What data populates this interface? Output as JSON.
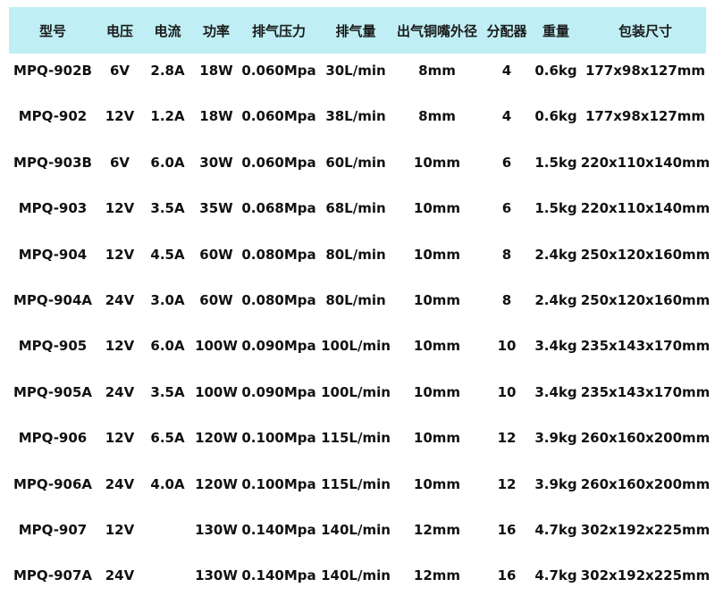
{
  "header": {
    "model": "型号",
    "voltage": "电压",
    "current": "电流",
    "power": "功率",
    "pressure": "排气压力",
    "flow": "排气量",
    "nozzle": "出气铜嘴外径",
    "distributor": "分配器",
    "weight": "重量",
    "package_size": "包装尺寸"
  },
  "rows": [
    {
      "model": "MPQ-902B",
      "voltage": "6V",
      "current": "2.8A",
      "power": "18W",
      "pressure": "0.060Mpa",
      "flow": "30L/min",
      "nozzle": "8mm",
      "distributor": "4",
      "weight": "0.6kg",
      "package_size": "177x98x127mm"
    },
    {
      "model": "MPQ-902",
      "voltage": "12V",
      "current": "1.2A",
      "power": "18W",
      "pressure": "0.060Mpa",
      "flow": "38L/min",
      "nozzle": "8mm",
      "distributor": "4",
      "weight": "0.6kg",
      "package_size": "177x98x127mm"
    },
    {
      "model": "MPQ-903B",
      "voltage": "6V",
      "current": "6.0A",
      "power": "30W",
      "pressure": "0.060Mpa",
      "flow": "60L/min",
      "nozzle": "10mm",
      "distributor": "6",
      "weight": "1.5kg",
      "package_size": "220x110x140mm"
    },
    {
      "model": "MPQ-903",
      "voltage": "12V",
      "current": "3.5A",
      "power": "35W",
      "pressure": "0.068Mpa",
      "flow": "68L/min",
      "nozzle": "10mm",
      "distributor": "6",
      "weight": "1.5kg",
      "package_size": "220x110x140mm"
    },
    {
      "model": "MPQ-904",
      "voltage": "12V",
      "current": "4.5A",
      "power": "60W",
      "pressure": "0.080Mpa",
      "flow": "80L/min",
      "nozzle": "10mm",
      "distributor": "8",
      "weight": "2.4kg",
      "package_size": "250x120x160mm"
    },
    {
      "model": "MPQ-904A",
      "voltage": "24V",
      "current": "3.0A",
      "power": "60W",
      "pressure": "0.080Mpa",
      "flow": "80L/min",
      "nozzle": "10mm",
      "distributor": "8",
      "weight": "2.4kg",
      "package_size": "250x120x160mm"
    },
    {
      "model": "MPQ-905",
      "voltage": "12V",
      "current": "6.0A",
      "power": "100W",
      "pressure": "0.090Mpa",
      "flow": "100L/min",
      "nozzle": "10mm",
      "distributor": "10",
      "weight": "3.4kg",
      "package_size": "235x143x170mm"
    },
    {
      "model": "MPQ-905A",
      "voltage": "24V",
      "current": "3.5A",
      "power": "100W",
      "pressure": "0.090Mpa",
      "flow": "100L/min",
      "nozzle": "10mm",
      "distributor": "10",
      "weight": "3.4kg",
      "package_size": "235x143x170mm"
    },
    {
      "model": "MPQ-906",
      "voltage": "12V",
      "current": "6.5A",
      "power": "120W",
      "pressure": "0.100Mpa",
      "flow": "115L/min",
      "nozzle": "10mm",
      "distributor": "12",
      "weight": "3.9kg",
      "package_size": "260x160x200mm"
    },
    {
      "model": "MPQ-906A",
      "voltage": "24V",
      "current": "4.0A",
      "power": "120W",
      "pressure": "0.100Mpa",
      "flow": "115L/min",
      "nozzle": "10mm",
      "distributor": "12",
      "weight": "3.9kg",
      "package_size": "260x160x200mm"
    },
    {
      "model": "MPQ-907",
      "voltage": "12V",
      "current": "",
      "power": "130W",
      "pressure": "0.140Mpa",
      "flow": "140L/min",
      "nozzle": "12mm",
      "distributor": "16",
      "weight": "4.7kg",
      "package_size": "302x192x225mm"
    },
    {
      "model": "MPQ-907A",
      "voltage": "24V",
      "current": "",
      "power": "130W",
      "pressure": "0.140Mpa",
      "flow": "140L/min",
      "nozzle": "12mm",
      "distributor": "16",
      "weight": "4.7kg",
      "package_size": "302x192x225mm"
    }
  ],
  "colors": {
    "header_background": "#bfeff4",
    "text": "#111111"
  }
}
